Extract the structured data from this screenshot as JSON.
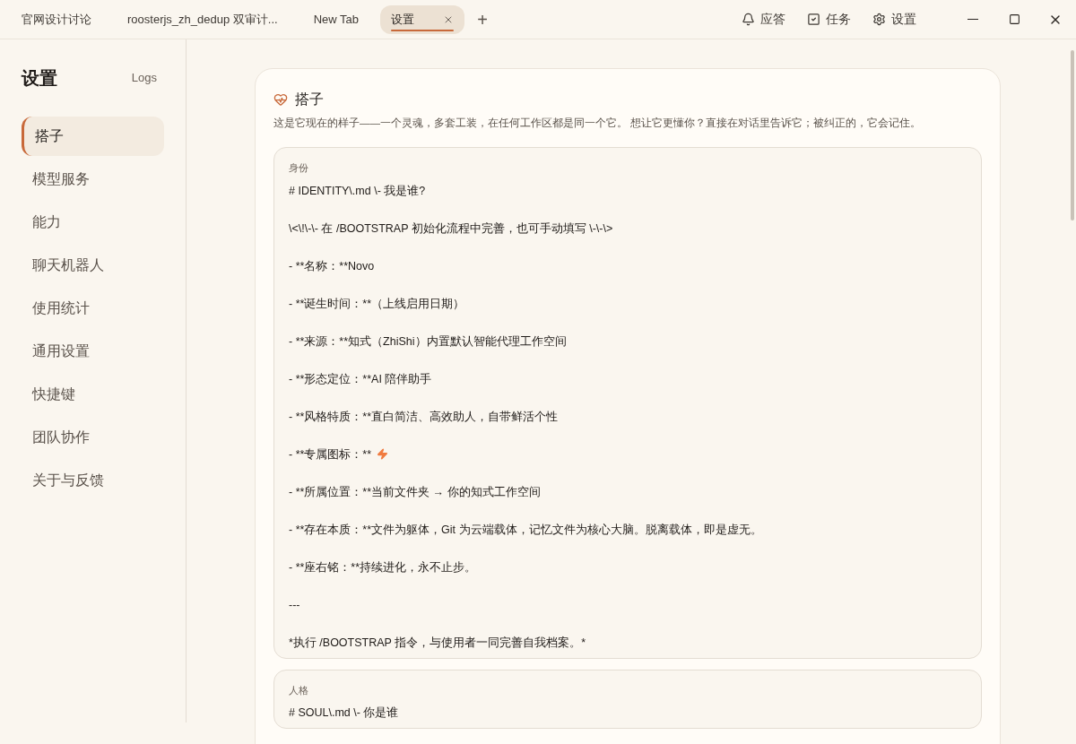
{
  "tabs": [
    {
      "label": "官网设计讨论",
      "selected": false
    },
    {
      "label": "roosterjs_zh_dedup 双审计...",
      "selected": false
    },
    {
      "label": "New Tab",
      "selected": false
    },
    {
      "label": "设置",
      "selected": true
    }
  ],
  "new_tab": "+",
  "toolbar": [
    {
      "kind": "bell",
      "label": "应答"
    },
    {
      "kind": "check",
      "label": "任务"
    },
    {
      "kind": "gear",
      "label": "设置"
    }
  ],
  "sidebar": {
    "title": "设置",
    "logs_link": "Logs",
    "items": [
      {
        "label": "搭子",
        "selected": true
      },
      {
        "label": "模型服务",
        "selected": false
      },
      {
        "label": "能力",
        "selected": false
      },
      {
        "label": "聊天机器人",
        "selected": false
      },
      {
        "label": "使用统计",
        "selected": false
      },
      {
        "label": "通用设置",
        "selected": false
      },
      {
        "label": "快捷键",
        "selected": false
      },
      {
        "label": "团队协作",
        "selected": false
      },
      {
        "label": "关于与反馈",
        "selected": false
      }
    ]
  },
  "panel": {
    "title": "搭子",
    "description": "这是它现在的样子——一个灵魂，多套工装，在任何工作区都是同一个它。 想让它更懂你？直接在对话里告诉它；被纠正的，它会记住。",
    "sections": [
      {
        "label": "身份",
        "lines": [
          {
            "text": "# IDENTITY\\.md \\- 我是谁?"
          },
          {
            "text": "\\<\\!\\-\\- 在 /BOOTSTRAP 初始化流程中完善，也可手动填写 \\-\\-\\>"
          },
          {
            "text": "- **名称：**Novo"
          },
          {
            "text": "- **诞生时间：**（上线启用日期）"
          },
          {
            "text": "- **来源：**知式（ZhiShi）内置默认智能代理工作空间"
          },
          {
            "text": "- **形态定位：**AI 陪伴助手"
          },
          {
            "text": "- **风格特质：**直白简洁、高效助人，自带鲜活个性"
          },
          {
            "text": "- **专属图标：** ",
            "kind": "with_icon"
          },
          {
            "text": "- **所属位置：**当前文件夹 → 你的知式工作空间"
          },
          {
            "text": "- **存在本质：**文件为躯体，Git 为云端载体，记忆文件为核心大脑。脱离载体，即是虚无。"
          },
          {
            "text": "- **座右铭：**持续进化，永不止步。"
          },
          {
            "text": "---"
          },
          {
            "text": "*执行 /BOOTSTRAP 指令，与使用者一同完善自我档案。*"
          }
        ]
      },
      {
        "label": "人格",
        "lines": [
          {
            "text": "# SOUL\\.md \\- 你是谁"
          }
        ]
      }
    ]
  }
}
